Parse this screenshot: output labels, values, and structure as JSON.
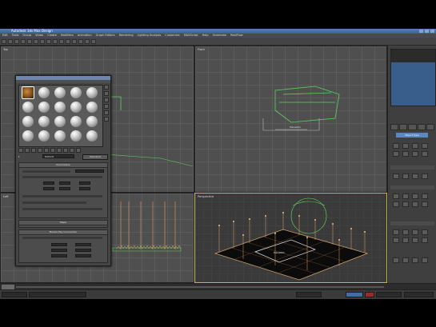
{
  "window": {
    "title": "Autodesk 3ds Max Design"
  },
  "menu": [
    "Edit",
    "Tools",
    "Group",
    "Views",
    "Create",
    "Modifiers",
    "Animation",
    "Graph Editors",
    "Rendering",
    "Lighting Analysis",
    "Customize",
    "MAXScript",
    "Help",
    "Illuminate",
    "RealFlow"
  ],
  "viewports": {
    "top_left": "Top",
    "top_right": "Front",
    "bottom_left": "Left",
    "bottom_right": "Perspective"
  },
  "material_editor": {
    "name_value": "Default",
    "type_button": "Standard",
    "rollouts": [
      "Parameters",
      "Maps",
      "Mental Ray Connection"
    ]
  },
  "command_panel": {
    "object_type_button": "Object Type"
  },
  "colors": {
    "selection_blue": "#3d6fa8",
    "active_viewport_border": "#c8b440",
    "helper_green": "#5fcf5f",
    "light_orange": "#e0a060"
  },
  "icons": [
    "material-sphere-icon",
    "viewport-helper-icon",
    "light-icon"
  ]
}
